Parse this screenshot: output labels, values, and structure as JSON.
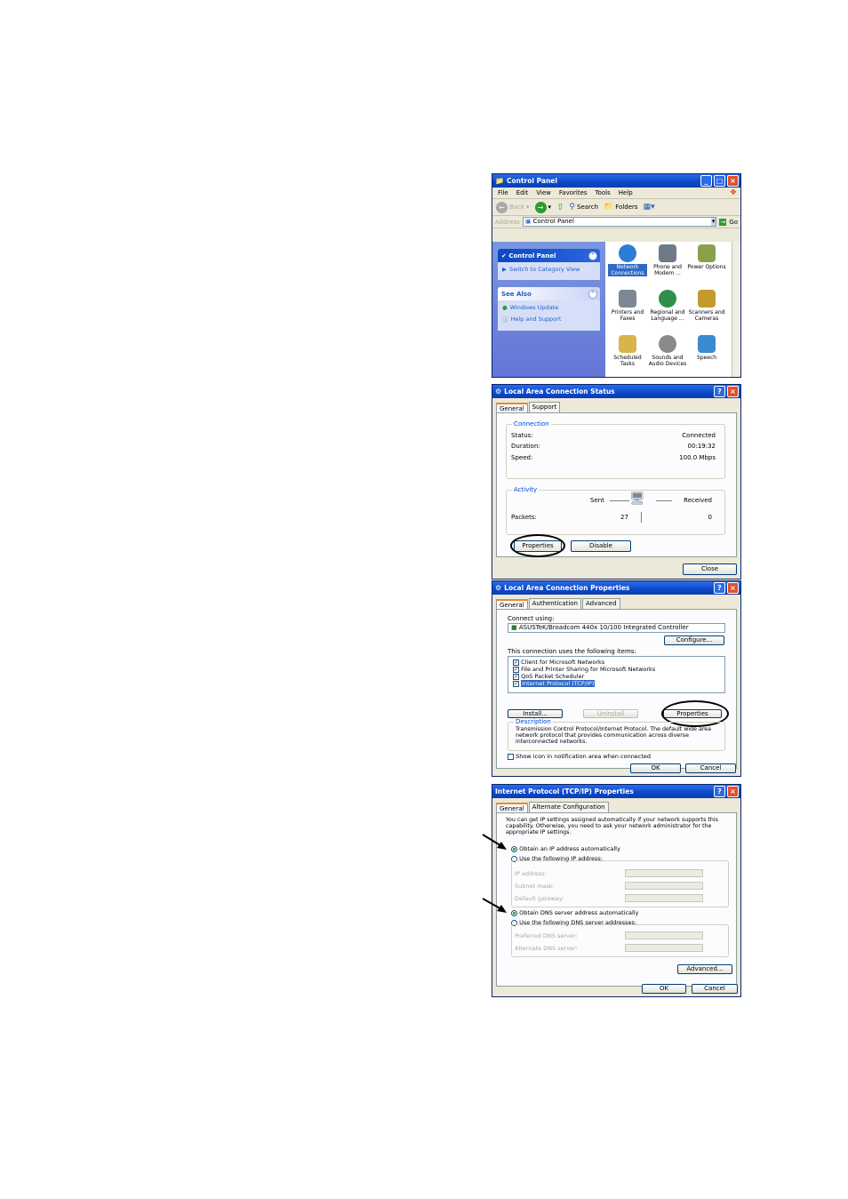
{
  "control_panel": {
    "title": "Control Panel",
    "menu": [
      "File",
      "Edit",
      "View",
      "Favorites",
      "Tools",
      "Help"
    ],
    "toolbar": {
      "back": "Back",
      "search": "Search",
      "folders": "Folders",
      "go": "Go"
    },
    "address_label": "Address",
    "address_value": "Control Panel",
    "sidebar": {
      "panel_title": "Control Panel",
      "switch_link": "Switch to Category View",
      "see_also_title": "See Also",
      "see_also_links": [
        "Windows Update",
        "Help and Support"
      ]
    },
    "icons": [
      {
        "label1": "Network",
        "label2": "Connections",
        "color": "#2a7fd4"
      },
      {
        "label1": "Phone and",
        "label2": "Modem ...",
        "color": "#6e7a8a"
      },
      {
        "label1": "Power Options",
        "label2": "",
        "color": "#8aa04a"
      },
      {
        "label1": "Printers and",
        "label2": "Faxes",
        "color": "#7d8894"
      },
      {
        "label1": "Regional and",
        "label2": "Language ...",
        "color": "#2f8f4a"
      },
      {
        "label1": "Scanners and",
        "label2": "Cameras",
        "color": "#c49a2c"
      },
      {
        "label1": "Scheduled",
        "label2": "Tasks",
        "color": "#d8b44a"
      },
      {
        "label1": "Sounds and",
        "label2": "Audio Devices",
        "color": "#8a8a8a"
      },
      {
        "label1": "Speech",
        "label2": "",
        "color": "#3a8ad0"
      }
    ]
  },
  "lan_status": {
    "title": "Local Area Connection Status",
    "tabs": [
      "General",
      "Support"
    ],
    "connection_label": "Connection",
    "status_label": "Status:",
    "status_value": "Connected",
    "duration_label": "Duration:",
    "duration_value": "00:19:32",
    "speed_label": "Speed:",
    "speed_value": "100.0 Mbps",
    "activity_label": "Activity",
    "sent_label": "Sent",
    "received_label": "Received",
    "packets_label": "Packets:",
    "packets_sent": "27",
    "packets_received": "0",
    "properties_button": "Properties",
    "disable_button": "Disable",
    "close_button": "Close"
  },
  "lan_properties": {
    "title": "Local Area Connection Properties",
    "tabs": [
      "General",
      "Authentication",
      "Advanced"
    ],
    "connect_using_label": "Connect using:",
    "adapter": "ASUSTeK/Broadcom 440x 10/100 Integrated Controller",
    "configure_button": "Configure...",
    "items_label": "This connection uses the following items:",
    "items": [
      "Client for Microsoft Networks",
      "File and Printer Sharing for Microsoft Networks",
      "QoS Packet Scheduler",
      "Internet Protocol (TCP/IP)"
    ],
    "install_button": "Install...",
    "uninstall_button": "Uninstall",
    "properties_button": "Properties",
    "description_label": "Description",
    "description_text": "Transmission Control Protocol/Internet Protocol. The default wide area network protocol that provides communication across diverse interconnected networks.",
    "notify_label": "Show icon in notification area when connected",
    "ok_button": "OK",
    "cancel_button": "Cancel"
  },
  "tcpip": {
    "title": "Internet Protocol (TCP/IP) Properties",
    "tabs": [
      "General",
      "Alternate Configuration"
    ],
    "intro": "You can get IP settings assigned automatically if your network supports this capability. Otherwise, you need to ask your network administrator for the appropriate IP settings.",
    "obtain_ip": "Obtain an IP address automatically",
    "use_ip": "Use the following IP address:",
    "ip_label": "IP address:",
    "mask_label": "Subnet mask:",
    "gateway_label": "Default gateway:",
    "obtain_dns": "Obtain DNS server address automatically",
    "use_dns": "Use the following DNS server addresses:",
    "pref_dns_label": "Preferred DNS server:",
    "alt_dns_label": "Alternate DNS server:",
    "advanced_button": "Advanced...",
    "ok_button": "OK",
    "cancel_button": "Cancel"
  }
}
